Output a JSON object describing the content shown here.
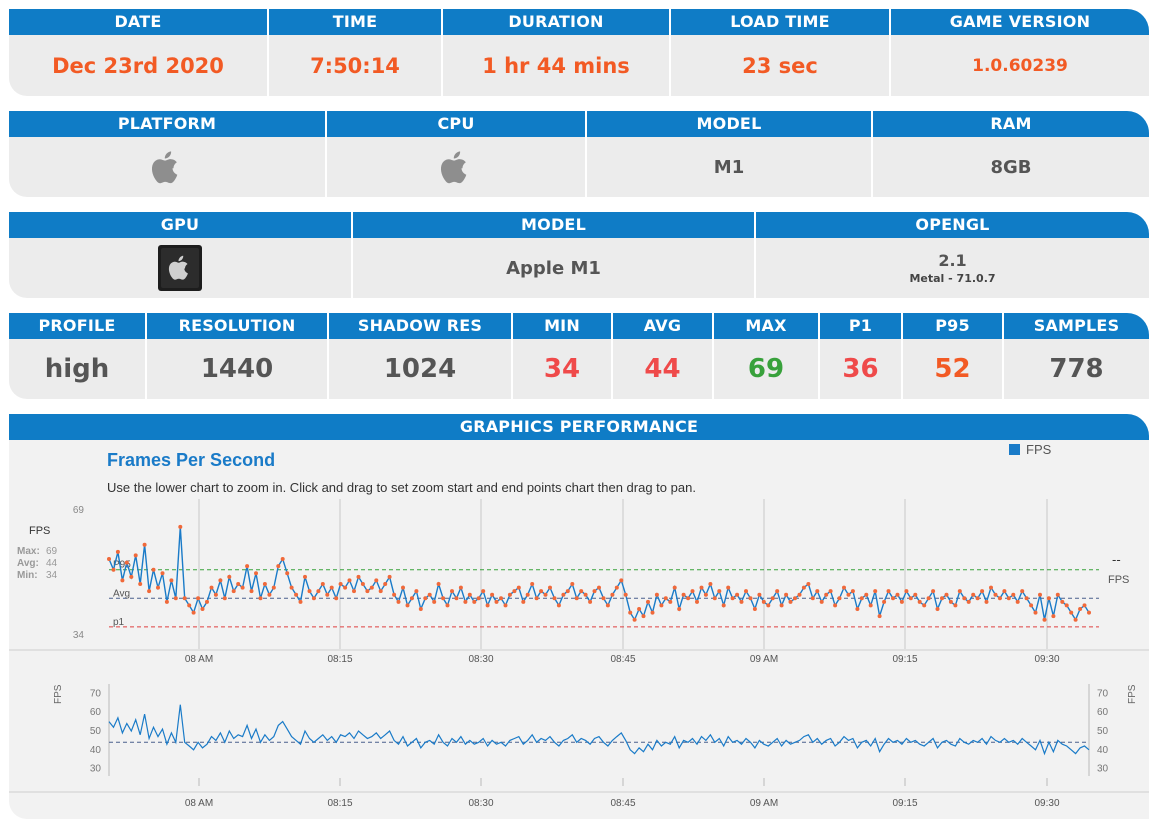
{
  "session": {
    "headers": [
      "DATE",
      "TIME",
      "DURATION",
      "LOAD TIME",
      "GAME VERSION"
    ],
    "values": [
      "Dec 23rd 2020",
      "7:50:14",
      "1 hr 44 mins",
      "23 sec",
      "1.0.60239"
    ]
  },
  "platform": {
    "headers": [
      "PLATFORM",
      "CPU",
      "MODEL",
      "RAM"
    ],
    "platform_icon": "apple-logo-icon",
    "cpu_icon": "apple-logo-icon",
    "model": "M1",
    "ram": "8GB"
  },
  "gpu": {
    "headers": [
      "GPU",
      "MODEL",
      "OPENGL"
    ],
    "gpu_icon": "apple-chip-icon",
    "model": "Apple M1",
    "opengl": "2.1",
    "opengl_sub": "Metal - 71.0.7"
  },
  "stats": {
    "headers": [
      "PROFILE",
      "RESOLUTION",
      "SHADOW RES",
      "MIN",
      "AVG",
      "MAX",
      "P1",
      "P95",
      "SAMPLES"
    ],
    "values": [
      "high",
      "1440",
      "1024",
      "34",
      "44",
      "69",
      "36",
      "52",
      "778"
    ]
  },
  "performance": {
    "header": "GRAPHICS PERFORMANCE",
    "title": "Frames Per Second",
    "description": "Use the lower chart to zoom in. Click and drag to set zoom start and end points chart then drag to pan.",
    "legend": "FPS",
    "left_axis_label": "FPS",
    "max_label": "Max:",
    "max_value": "69",
    "avg_label": "Avg:",
    "avg_value": "44",
    "min_label": "Min:",
    "min_value": "34",
    "right_dash": "--",
    "right_unit": "FPS"
  },
  "colors": {
    "header_blue": "#0f7cc6",
    "line_blue": "#1a7bc8",
    "dot_orange": "#f0693a",
    "p95_green": "#38a13b",
    "p1_red": "#e04040",
    "avg_navy": "#4a5f8c"
  },
  "chart_data": [
    {
      "type": "line",
      "title": "Frames Per Second",
      "series": [
        {
          "name": "FPS",
          "values": [
            55,
            52,
            57,
            49,
            54,
            50,
            56,
            48,
            59,
            46,
            52,
            47,
            51,
            43,
            49,
            44,
            64,
            44,
            42,
            40,
            44,
            41,
            43,
            47,
            45,
            49,
            44,
            50,
            46,
            48,
            47,
            53,
            46,
            51,
            44,
            48,
            45,
            47,
            53,
            55,
            51,
            47,
            45,
            43,
            50,
            46,
            44,
            46,
            48,
            45,
            47,
            44,
            48,
            47,
            49,
            46,
            50,
            48,
            46,
            47,
            49,
            46,
            48,
            50,
            45,
            43,
            47,
            42,
            44,
            46,
            41,
            44,
            45,
            43,
            48,
            44,
            42,
            46,
            44,
            47,
            43,
            45,
            43,
            44,
            46,
            42,
            45,
            43,
            44,
            42,
            45,
            46,
            47,
            43,
            45,
            48,
            44,
            46,
            45,
            47,
            44,
            42,
            45,
            46,
            48,
            44,
            46,
            45,
            43,
            46,
            47,
            44,
            42,
            45,
            47,
            49,
            45,
            40,
            38,
            41,
            39,
            43,
            40,
            45,
            42,
            44,
            43,
            47,
            41,
            45,
            44,
            46,
            43,
            47,
            45,
            48,
            44,
            46,
            42,
            47,
            44,
            45,
            43,
            46,
            44,
            41,
            45,
            43,
            42,
            44,
            46,
            42,
            45,
            43,
            44,
            45,
            47,
            48,
            44,
            46,
            43,
            45,
            46,
            42,
            44,
            47,
            45,
            46,
            41,
            44,
            45,
            42,
            46,
            39,
            43,
            46,
            44,
            45,
            43,
            46,
            44,
            45,
            43,
            42,
            44,
            46,
            41,
            44,
            45,
            43,
            42,
            46,
            44,
            43,
            45,
            44,
            46,
            43,
            47,
            45,
            44,
            46,
            44,
            45,
            43,
            46,
            44,
            42,
            40,
            45,
            38,
            44,
            39,
            45,
            43,
            42,
            40,
            38,
            41,
            42,
            40
          ]
        }
      ],
      "x_tick_labels": [
        "08 AM",
        "08:15",
        "08:30",
        "08:45",
        "09 AM",
        "09:15",
        "09:30"
      ],
      "xlabel": "",
      "ylabel": "FPS",
      "y_tick_labels": [
        "69",
        "34"
      ],
      "ylim": [
        34,
        69
      ],
      "reference_lines": [
        {
          "name": "P95",
          "label": "P95",
          "value": 52
        },
        {
          "name": "Avg",
          "label": "Avg",
          "value": 44
        },
        {
          "name": "p1",
          "label": "p1",
          "value": 36
        }
      ],
      "grid": "vertical"
    },
    {
      "type": "line",
      "series": [
        {
          "name": "FPS",
          "values": [
            55,
            52,
            57,
            49,
            54,
            50,
            56,
            48,
            59,
            46,
            52,
            47,
            51,
            43,
            49,
            44,
            64,
            44,
            42,
            40,
            44,
            41,
            43,
            47,
            45,
            49,
            44,
            50,
            46,
            48,
            47,
            53,
            46,
            51,
            44,
            48,
            45,
            47,
            53,
            55,
            51,
            47,
            45,
            43,
            50,
            46,
            44,
            46,
            48,
            45,
            47,
            44,
            48,
            47,
            49,
            46,
            50,
            48,
            46,
            47,
            49,
            46,
            48,
            50,
            45,
            43,
            47,
            42,
            44,
            46,
            41,
            44,
            45,
            43,
            48,
            44,
            42,
            46,
            44,
            47,
            43,
            45,
            43,
            44,
            46,
            42,
            45,
            43,
            44,
            42,
            45,
            46,
            47,
            43,
            45,
            48,
            44,
            46,
            45,
            47,
            44,
            42,
            45,
            46,
            48,
            44,
            46,
            45,
            43,
            46,
            47,
            44,
            42,
            45,
            47,
            49,
            45,
            40,
            38,
            41,
            39,
            43,
            40,
            45,
            42,
            44,
            43,
            47,
            41,
            45,
            44,
            46,
            43,
            47,
            45,
            48,
            44,
            46,
            42,
            47,
            44,
            45,
            43,
            46,
            44,
            41,
            45,
            43,
            42,
            44,
            46,
            42,
            45,
            43,
            44,
            45,
            47,
            48,
            44,
            46,
            43,
            45,
            46,
            42,
            44,
            47,
            45,
            46,
            41,
            44,
            45,
            42,
            46,
            39,
            43,
            46,
            44,
            45,
            43,
            46,
            44,
            45,
            43,
            42,
            44,
            46,
            41,
            44,
            45,
            43,
            42,
            46,
            44,
            43,
            45,
            44,
            46,
            43,
            47,
            45,
            44,
            46,
            44,
            45,
            43,
            46,
            44,
            42,
            40,
            45,
            38,
            44,
            39,
            45,
            43,
            42,
            40,
            38,
            41,
            42,
            40
          ]
        }
      ],
      "x_tick_labels": [
        "08 AM",
        "08:15",
        "08:30",
        "08:45",
        "09 AM",
        "09:15",
        "09:30"
      ],
      "ylabel": "FPS",
      "y_tick_labels": [
        "70",
        "60",
        "50",
        "40",
        "30"
      ],
      "ylim": [
        25,
        75
      ],
      "reference_lines": [
        {
          "name": "avg",
          "value": 44
        }
      ]
    }
  ]
}
